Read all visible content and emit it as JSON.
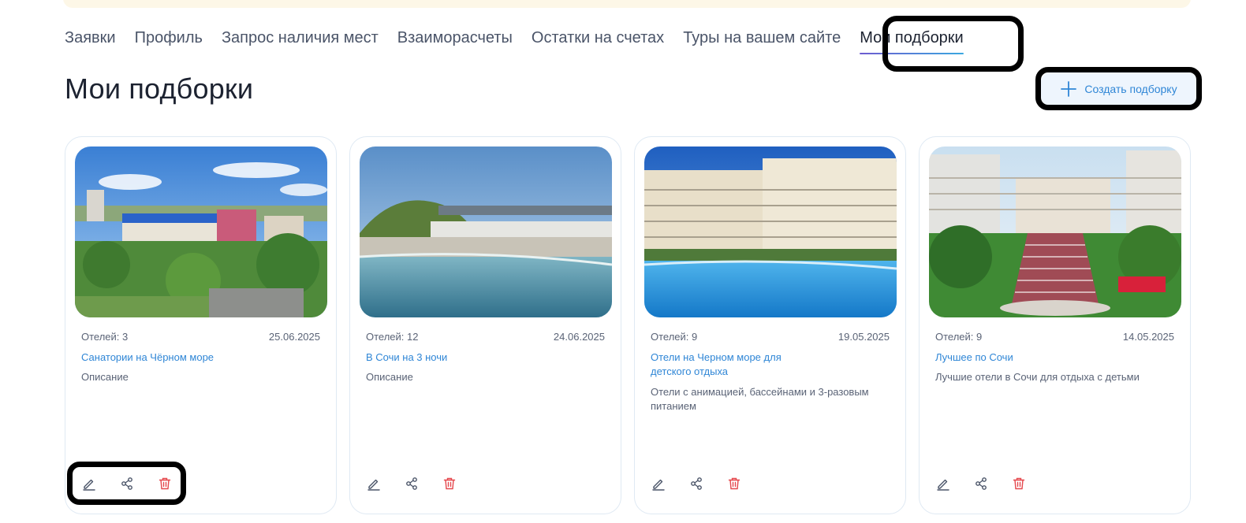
{
  "nav": {
    "tabs": [
      {
        "label": "Заявки"
      },
      {
        "label": "Профиль"
      },
      {
        "label": "Запрос наличия мест"
      },
      {
        "label": "Взаиморасчеты"
      },
      {
        "label": "Остатки на счетах"
      },
      {
        "label": "Туры на вашем сайте"
      },
      {
        "label": "Мои подборки"
      }
    ],
    "active_index": 6
  },
  "page": {
    "title": "Мои подборки",
    "create_button": "Создать подборку"
  },
  "cards": [
    {
      "hotels": "Отелей: 3",
      "date": "25.06.2025",
      "title": "Санатории на Чёрном море",
      "description": "Описание",
      "image": "resort-town-aerial-photo"
    },
    {
      "hotels": "Отелей: 12",
      "date": "24.06.2025",
      "title": "В Сочи на 3 ночи",
      "description": "Описание",
      "image": "pebble-beach-sea-photo"
    },
    {
      "hotels": "Отелей: 9",
      "date": "19.05.2025",
      "title": "Отели на Черном море для детского отдыха",
      "description": "Отели с анимацией, бассейнами и 3-разовым питанием",
      "image": "hotel-pool-photo"
    },
    {
      "hotels": "Отелей: 9",
      "date": "14.05.2025",
      "title": "Лучшее по Сочи",
      "description": "Лучшие отели в Сочи для отдыха с детьми",
      "image": "hotel-garden-stairs-photo"
    }
  ],
  "colors": {
    "accent": "#2f86d6",
    "delete": "#e5484d",
    "highlight": "#000000"
  },
  "icons": {
    "edit": "pencil-icon",
    "share": "share-icon",
    "delete": "trash-icon",
    "create": "plus-icon"
  }
}
